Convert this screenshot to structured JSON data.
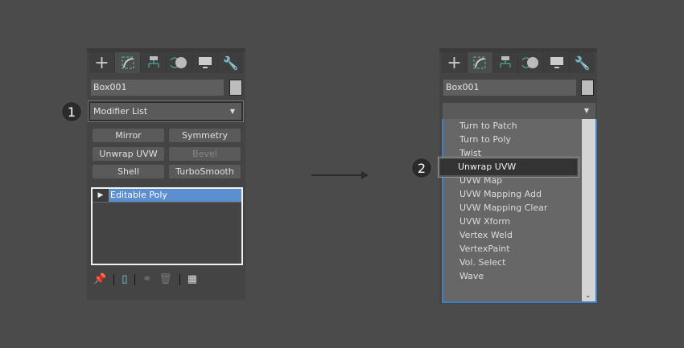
{
  "step1": {
    "badge": "1"
  },
  "step2": {
    "badge": "2"
  },
  "left_panel": {
    "tabs": [
      "create-icon",
      "modify-icon",
      "hierarchy-icon",
      "motion-icon",
      "display-icon",
      "utilities-icon"
    ],
    "object_name": "Box001",
    "modifier_list": "Modifier List",
    "buttons": [
      {
        "label": "Mirror",
        "enabled": true
      },
      {
        "label": "Symmetry",
        "enabled": true
      },
      {
        "label": "Unwrap UVW",
        "enabled": true
      },
      {
        "label": "Bevel",
        "enabled": false
      },
      {
        "label": "Shell",
        "enabled": true
      },
      {
        "label": "TurboSmooth",
        "enabled": true
      }
    ],
    "stack": [
      {
        "label": "Editable Poly",
        "selected": true
      }
    ],
    "toolbar": [
      "pin-stack-icon",
      "show-end-result-icon",
      "make-unique-icon",
      "remove-modifier-icon",
      "configure-modifier-sets-icon"
    ]
  },
  "right_panel": {
    "object_name": "Box001",
    "modifier_list": "",
    "items": [
      "Turn to Patch",
      "Turn to Poly",
      "Twist",
      "Unwrap UVW",
      "UVW Map",
      "UVW Mapping Add",
      "UVW Mapping Clear",
      "UVW Xform",
      "Vertex Weld",
      "VertexPaint",
      "Vol. Select",
      "Wave"
    ],
    "highlighted": "Unwrap UVW"
  },
  "colors": {
    "accent_select": "#5b8fd0",
    "list_border": "#3d7fc0",
    "icon_teal": "#4fc3b5"
  }
}
